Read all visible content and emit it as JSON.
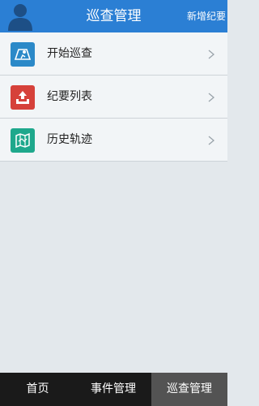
{
  "header": {
    "title": "巡查管理",
    "add_label": "新增纪要"
  },
  "menu": {
    "items": [
      {
        "label": "开始巡查",
        "icon": "map-icon",
        "color": "#2b89c8"
      },
      {
        "label": "纪要列表",
        "icon": "upload-tray-icon",
        "color": "#d6413a"
      },
      {
        "label": "历史轨迹",
        "icon": "folded-map-icon",
        "color": "#1ea88c"
      }
    ]
  },
  "tabbar": {
    "tabs": [
      {
        "label": "首页"
      },
      {
        "label": "事件管理"
      },
      {
        "label": "巡查管理",
        "active": true
      }
    ]
  },
  "colors": {
    "header_bg": "#2b7fd4",
    "tabbar_bg": "#1a1a1a",
    "tab_active_bg": "#535353"
  }
}
